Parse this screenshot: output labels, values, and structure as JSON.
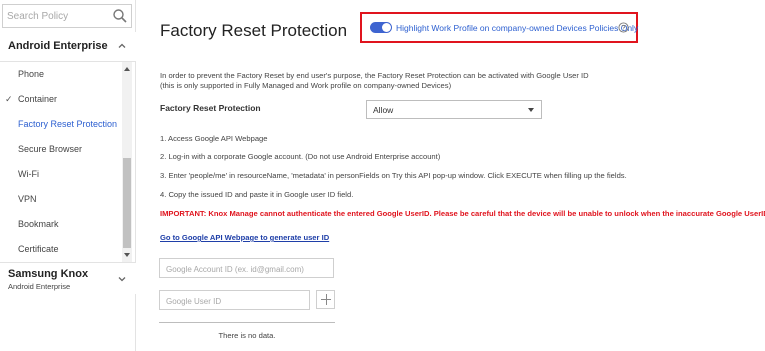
{
  "sidebar": {
    "search": {
      "placeholder": "Search Policy",
      "value": ""
    },
    "sections": [
      {
        "title": "Android Enterprise",
        "subtitle": "",
        "expanded": true,
        "items": [
          {
            "label": "Phone",
            "checked": false,
            "active": false
          },
          {
            "label": "Container",
            "checked": true,
            "active": false
          },
          {
            "label": "Factory Reset Protection",
            "checked": false,
            "active": true
          },
          {
            "label": "Secure Browser",
            "checked": false,
            "active": false
          },
          {
            "label": "Wi-Fi",
            "checked": false,
            "active": false
          },
          {
            "label": "VPN",
            "checked": false,
            "active": false
          },
          {
            "label": "Bookmark",
            "checked": false,
            "active": false
          },
          {
            "label": "Certificate",
            "checked": false,
            "active": false
          }
        ]
      },
      {
        "title": "Samsung Knox",
        "subtitle": "Android Enterprise",
        "expanded": false
      }
    ],
    "check_glyph": "✓"
  },
  "main": {
    "title": "Factory Reset Protection",
    "highlight_toggle": {
      "label": "Highlight Work Profile on company-owned Devices Policies Only",
      "on": true,
      "accent_color": "#3e64d0",
      "frame_color": "#e0141e"
    },
    "description_lines": [
      "In order to prevent the Factory Reset by end user's purpose, the Factory Reset Protection can be activated with Google User ID",
      "(this is only supported in Fully Managed and Work profile on company-owned Devices)"
    ],
    "frp_field": {
      "label": "Factory Reset Protection",
      "value": "Allow"
    },
    "steps": [
      "1. Access Google API Webpage",
      "2. Log-in with a corporate Google account. (Do not use Android Enterprise account)",
      "3. Enter 'people/me' in resourceName, 'metadata' in personFields on Try this API pop-up window. Click EXECUTE when filling up the fields.",
      "4. Copy the issued ID and paste it in Google user ID field."
    ],
    "important": "IMPORTANT: Knox Manage cannot authenticate the entered Google UserID. Please be careful that the device will be unable to unlock when the inaccurate Google UserID entered.",
    "api_link": "Go to Google API Webpage to generate user ID",
    "account_input": {
      "placeholder": "Google Account ID (ex. id@gmail.com)",
      "value": ""
    },
    "userid_input": {
      "placeholder": "Google User ID",
      "value": ""
    },
    "empty_list": "There is no data."
  }
}
